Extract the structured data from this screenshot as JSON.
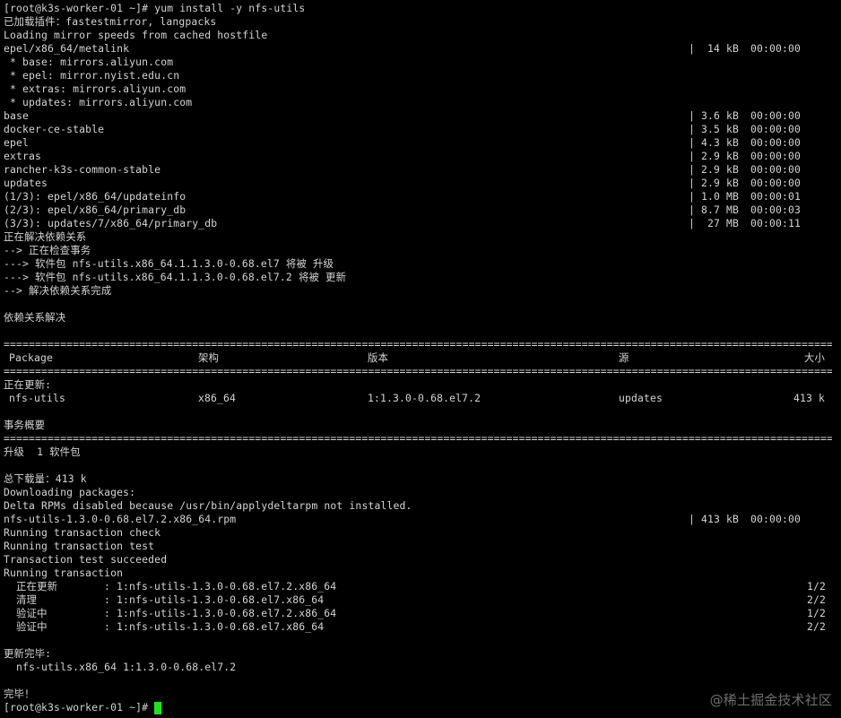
{
  "prompt": "[root@k3s-worker-01 ~]# ",
  "command": "yum install -y nfs-utils",
  "plugins_line": "已加载插件：fastestmirror, langpacks",
  "loading_line": "Loading mirror speeds from cached hostfile",
  "metalink": {
    "name": "epel/x86_64/metalink",
    "size": "14 kB",
    "time": "00:00:00"
  },
  "mirrors": [
    " * base: mirrors.aliyun.com",
    " * epel: mirror.nyist.edu.cn",
    " * extras: mirrors.aliyun.com",
    " * updates: mirrors.aliyun.com"
  ],
  "repos": [
    {
      "name": "base",
      "size": "3.6 kB",
      "time": "00:00:00"
    },
    {
      "name": "docker-ce-stable",
      "size": "3.5 kB",
      "time": "00:00:00"
    },
    {
      "name": "epel",
      "size": "4.3 kB",
      "time": "00:00:00"
    },
    {
      "name": "extras",
      "size": "2.9 kB",
      "time": "00:00:00"
    },
    {
      "name": "rancher-k3s-common-stable",
      "size": "2.9 kB",
      "time": "00:00:00"
    },
    {
      "name": "updates",
      "size": "2.9 kB",
      "time": "00:00:00"
    },
    {
      "name": "(1/3): epel/x86_64/updateinfo",
      "size": "1.0 MB",
      "time": "00:00:01"
    },
    {
      "name": "(2/3): epel/x86_64/primary_db",
      "size": "8.7 MB",
      "time": "00:00:03"
    },
    {
      "name": "(3/3): updates/7/x86_64/primary_db",
      "size": "27 MB",
      "time": "00:00:11"
    }
  ],
  "resolving": [
    "正在解决依赖关系",
    "--> 正在检查事务",
    "---> 软件包 nfs-utils.x86_64.1.1.3.0-0.68.el7 将被 升级",
    "---> 软件包 nfs-utils.x86_64.1.1.3.0-0.68.el7.2 将被 更新",
    "--> 解决依赖关系完成"
  ],
  "deps_resolved": "依赖关系解决",
  "separator": "================================================================================================================================================================================",
  "table": {
    "headers": {
      "package": "Package",
      "arch": "架构",
      "version": "版本",
      "repo": "源",
      "size": "大小"
    },
    "section": "正在更新:",
    "row": {
      "package": "nfs-utils",
      "arch": "x86_64",
      "version": "1:1.3.0-0.68.el7.2",
      "repo": "updates",
      "size": "413 k"
    }
  },
  "summary_title": "事务概要",
  "upgrade_line": "升级  1 软件包",
  "total_download": "总下载量：413 k",
  "downloading": "Downloading packages:",
  "delta_line": "Delta RPMs disabled because /usr/bin/applydeltarpm not installed.",
  "rpm": {
    "name": "nfs-utils-1.3.0-0.68.el7.2.x86_64.rpm",
    "size": "413 kB",
    "time": "00:00:00"
  },
  "running": [
    "Running transaction check",
    "Running transaction test",
    "Transaction test succeeded",
    "Running transaction"
  ],
  "steps": [
    {
      "action": "正在更新",
      "pkg": ": 1:nfs-utils-1.3.0-0.68.el7.2.x86_64",
      "count": "1/2"
    },
    {
      "action": "清理",
      "pkg": ": 1:nfs-utils-1.3.0-0.68.el7.x86_64",
      "count": "2/2"
    },
    {
      "action": "验证中",
      "pkg": ": 1:nfs-utils-1.3.0-0.68.el7.2.x86_64",
      "count": "1/2"
    },
    {
      "action": "验证中",
      "pkg": ": 1:nfs-utils-1.3.0-0.68.el7.x86_64",
      "count": "2/2"
    }
  ],
  "updated_title": "更新完毕:",
  "updated_pkg": "  nfs-utils.x86_64 1:1.3.0-0.68.el7.2",
  "done": "完毕！",
  "final_prompt": "[root@k3s-worker-01 ~]# ",
  "watermark": "@稀土掘金技术社区",
  "bar": "|",
  "colors": {
    "background": "#000000",
    "text": "#d4d4d4",
    "cursor": "#19e619"
  }
}
